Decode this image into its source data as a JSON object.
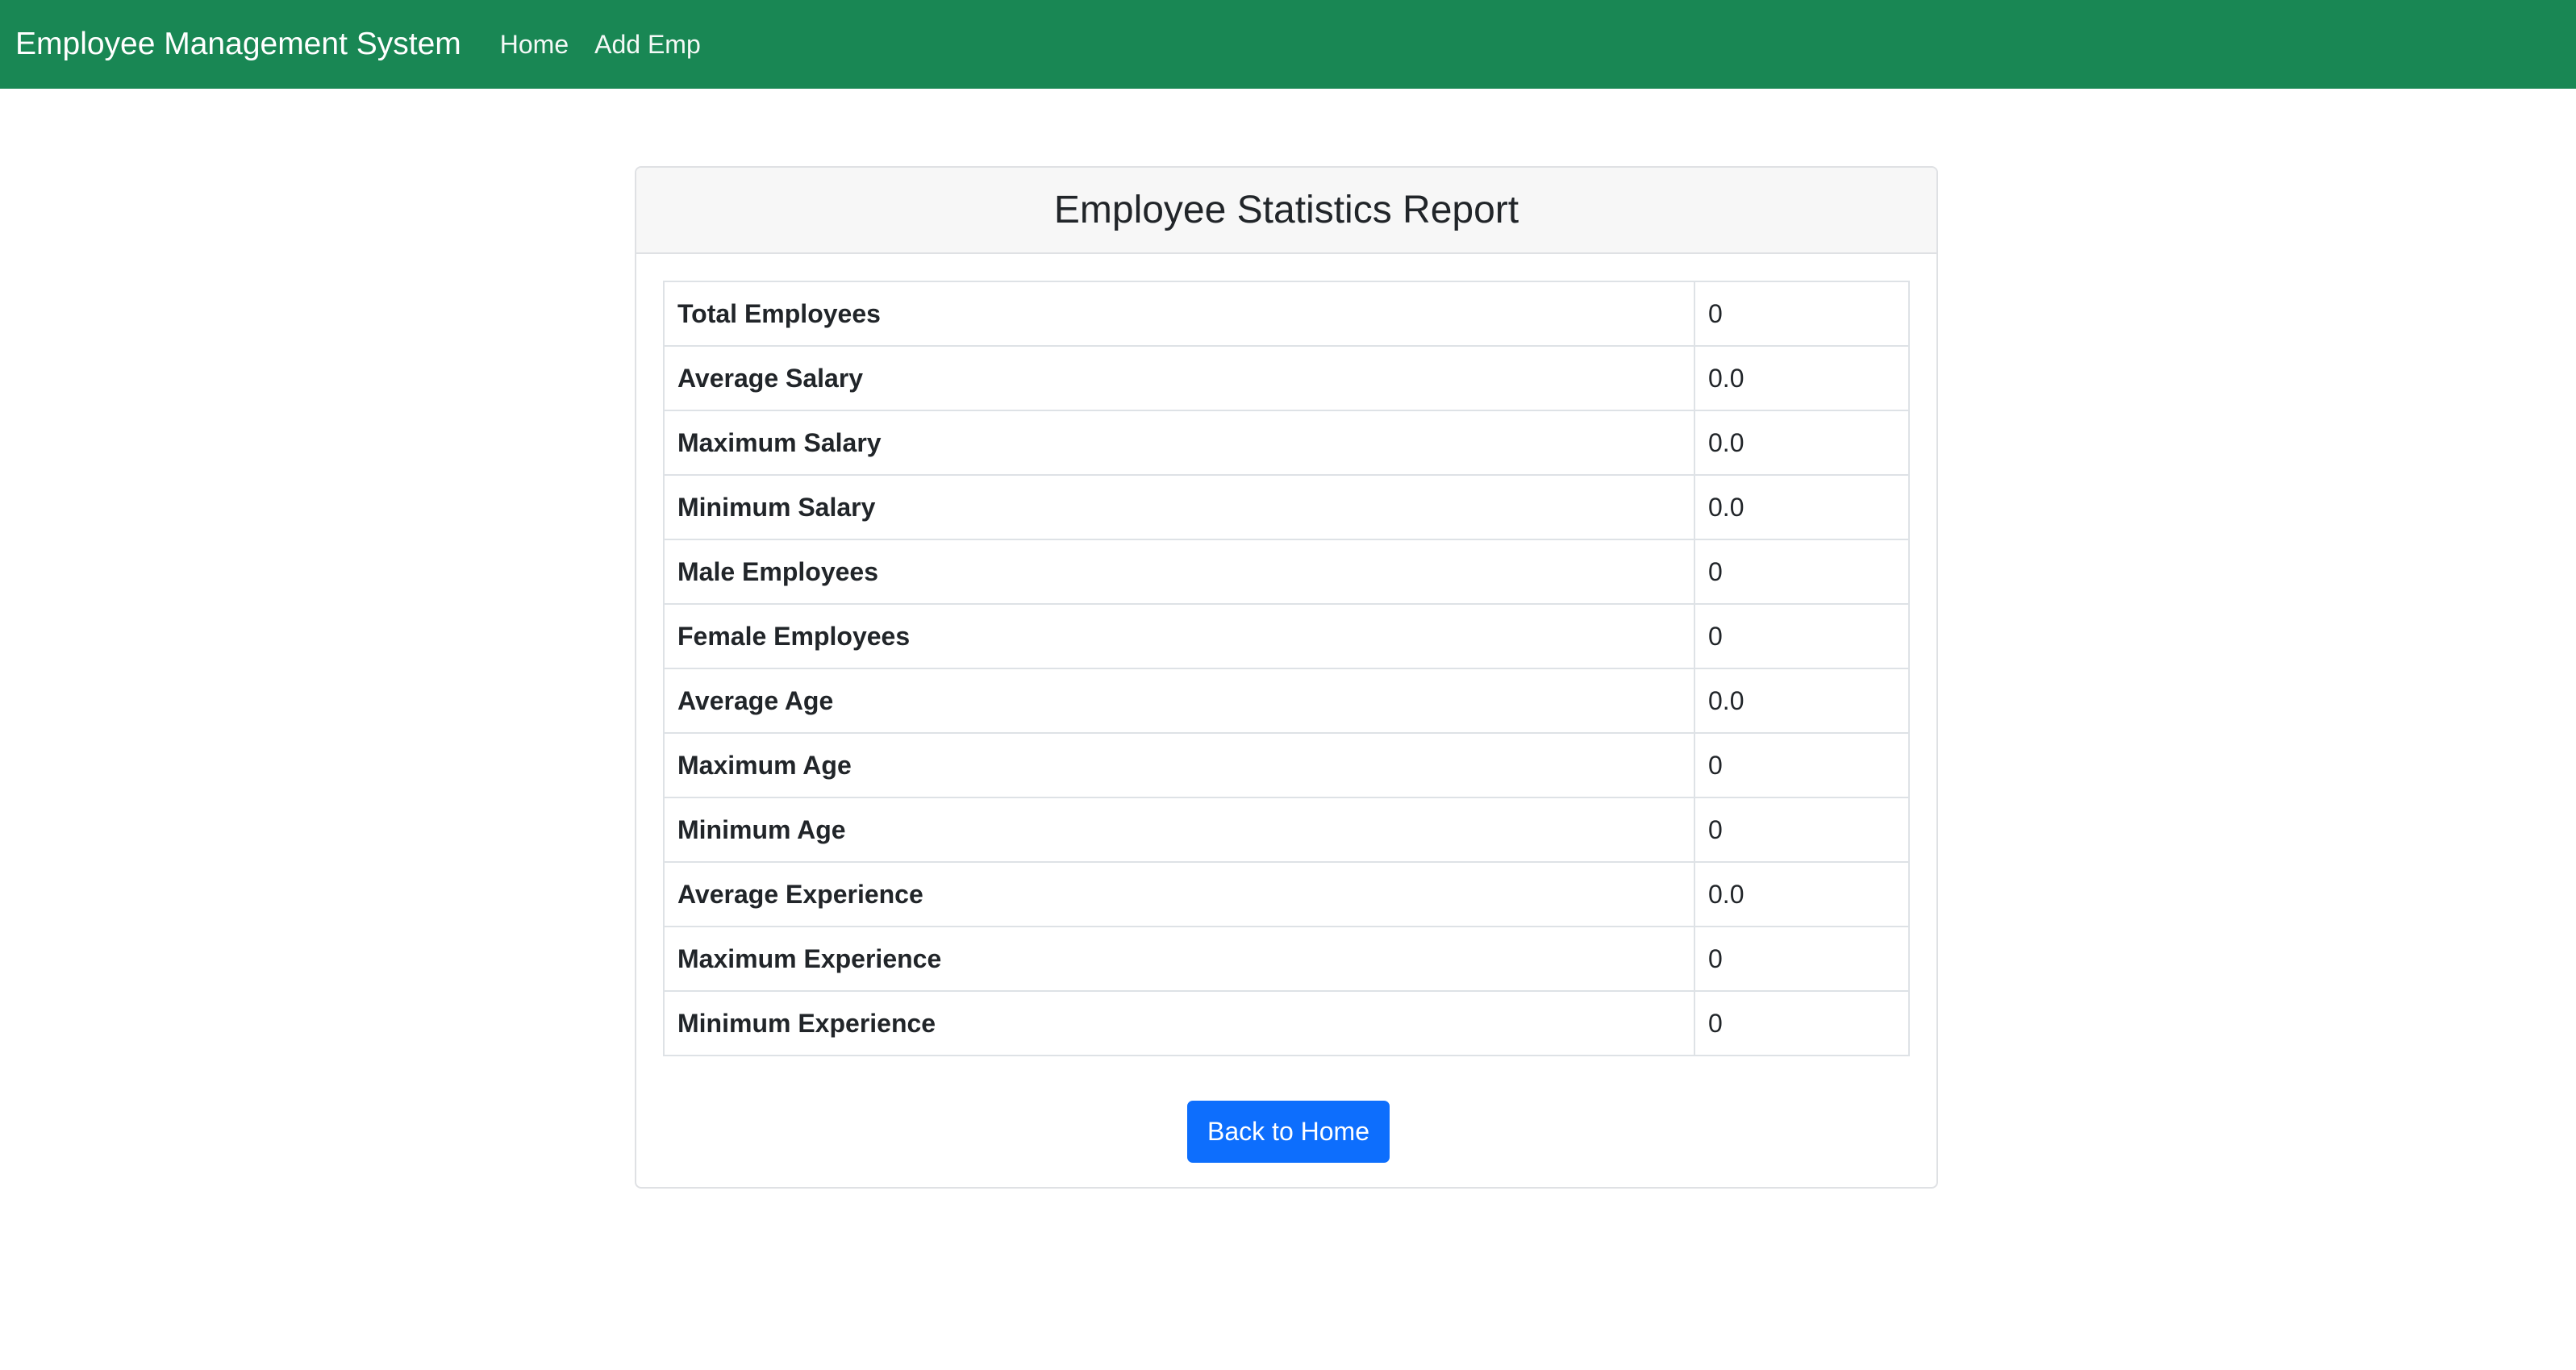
{
  "navbar": {
    "brand": "Employee Management System",
    "links": [
      "Home",
      "Add Emp"
    ],
    "color": "#198754"
  },
  "report": {
    "title": "Employee Statistics Report",
    "rows": [
      {
        "label": "Total Employees",
        "value": "0"
      },
      {
        "label": "Average Salary",
        "value": "0.0"
      },
      {
        "label": "Maximum Salary",
        "value": "0.0"
      },
      {
        "label": "Minimum Salary",
        "value": "0.0"
      },
      {
        "label": "Male Employees",
        "value": "0"
      },
      {
        "label": "Female Employees",
        "value": "0"
      },
      {
        "label": "Average Age",
        "value": "0.0"
      },
      {
        "label": "Maximum Age",
        "value": "0"
      },
      {
        "label": "Minimum Age",
        "value": "0"
      },
      {
        "label": "Average Experience",
        "value": "0.0"
      },
      {
        "label": "Maximum Experience",
        "value": "0"
      },
      {
        "label": "Minimum Experience",
        "value": "0"
      }
    ],
    "back_button": "Back to Home",
    "button_color": "#0d6efd"
  }
}
